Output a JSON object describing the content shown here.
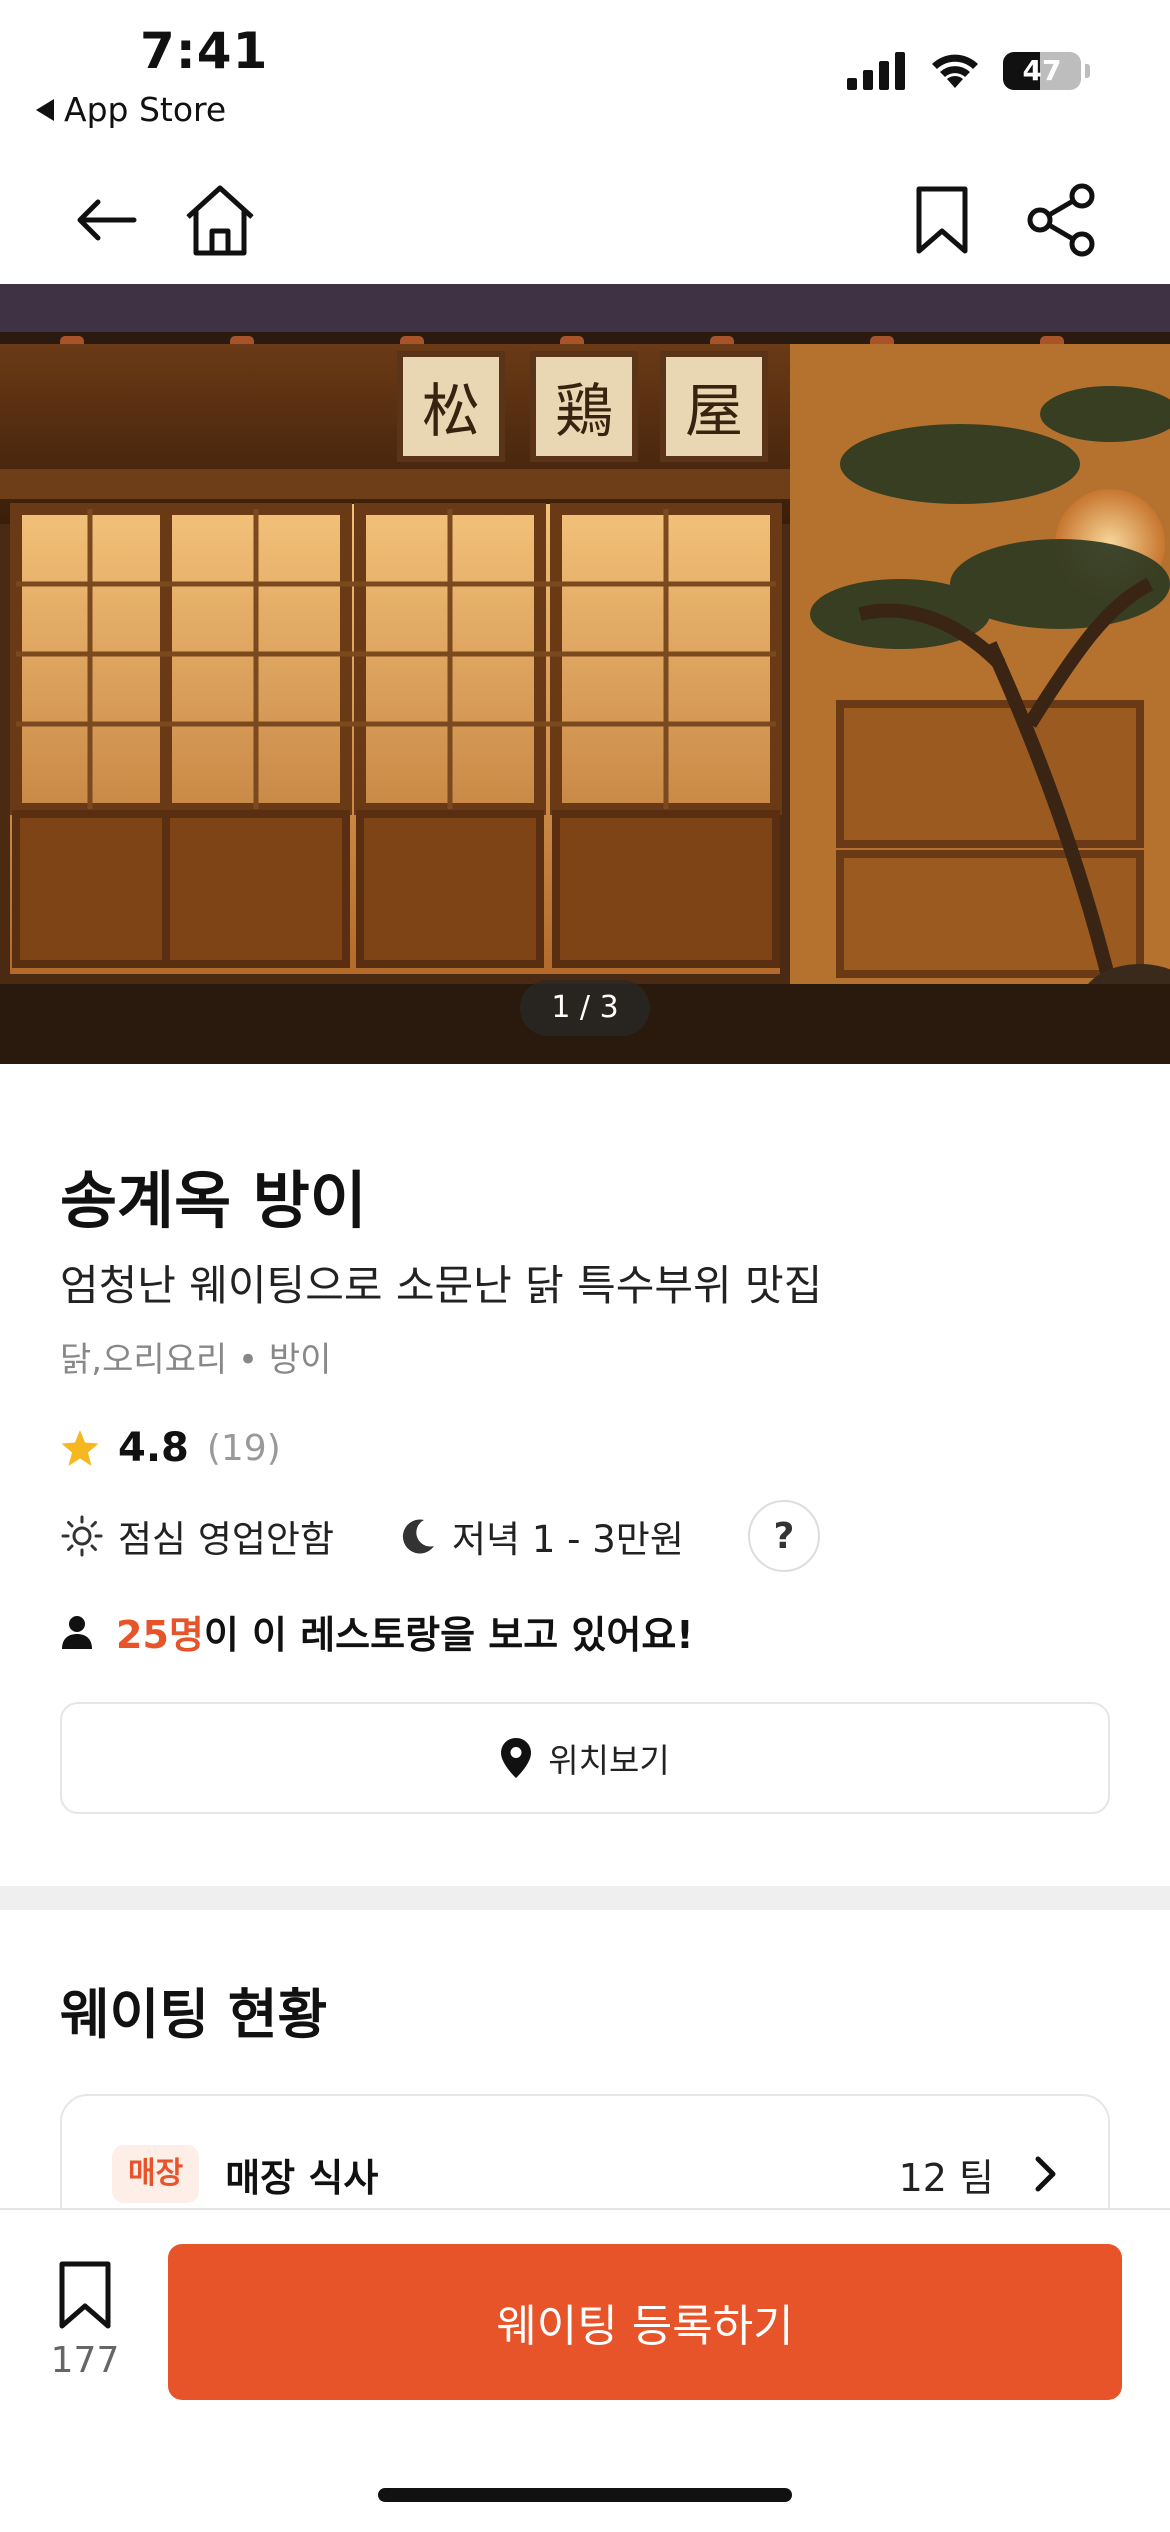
{
  "status_bar": {
    "time": "7:41",
    "back_app_label": "App Store",
    "battery_percent": "47",
    "battery_level": 0.47
  },
  "nav": {
    "back_icon": "arrow-left-icon",
    "home_icon": "home-icon",
    "bookmark_icon": "bookmark-icon",
    "share_icon": "share-icon"
  },
  "hero": {
    "sign_chars": [
      "松",
      "鶏",
      "屋"
    ],
    "page_indicator": "1 / 3"
  },
  "restaurant": {
    "name": "송계옥 방이",
    "tagline": "엄청난 웨이팅으로 소문난 닭 특수부위 맛집",
    "category": "닭,오리요리 • 방이",
    "rating": "4.8",
    "review_count": "(19)",
    "lunch_label": "점심 영업안함",
    "dinner_label": "저녁 1 - 3만원",
    "help_label": "?",
    "viewers_count": "25명",
    "viewers_text": "이 이 레스토랑을 보고 있어요!",
    "location_label": "위치보기"
  },
  "waiting": {
    "section_title": "웨이팅 현황",
    "rows": [
      {
        "badge": "매장",
        "label": "매장 식사",
        "count": "12 팀"
      }
    ]
  },
  "bottom_bar": {
    "bookmark_count": "177",
    "primary_label": "웨이팅 등록하기"
  },
  "colors": {
    "accent": "#e8542a",
    "star": "#f5b820",
    "badge_bg": "#fdeee7"
  }
}
